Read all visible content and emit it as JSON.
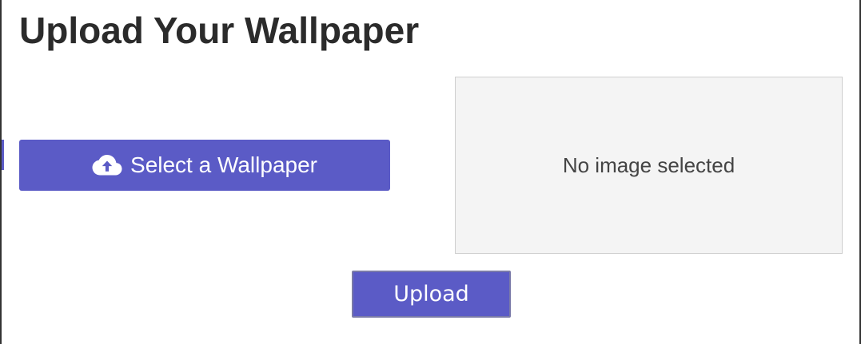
{
  "page": {
    "title": "Upload Your Wallpaper"
  },
  "select_button": {
    "label": "Select a Wallpaper",
    "icon": "cloud-upload-icon"
  },
  "preview": {
    "empty_text": "No image selected"
  },
  "upload_button": {
    "label": "Upload"
  },
  "colors": {
    "accent": "#5b5bc6",
    "preview_bg": "#f4f4f4",
    "title_text": "#2b2b2b"
  }
}
